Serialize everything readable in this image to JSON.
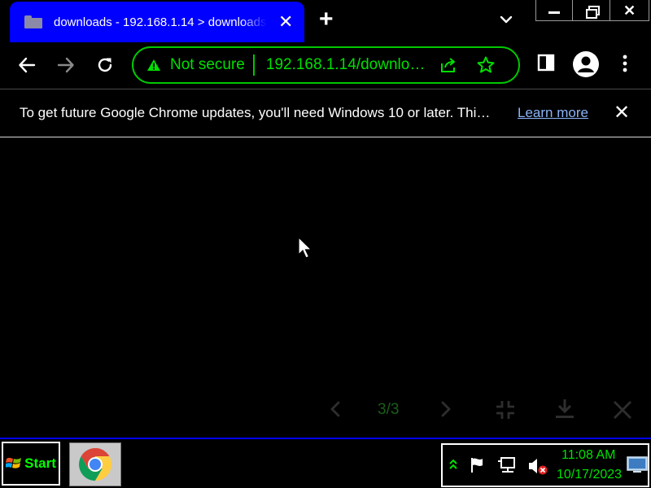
{
  "browser": {
    "tab": {
      "title": "downloads - 192.168.1.14 > downloads"
    },
    "omnibox": {
      "security_label": "Not secure",
      "url": "192.168.1.14/downloads"
    },
    "infobar": {
      "message": "To get future Google Chrome updates, you'll need Windows 10 or later. Thi…",
      "link_label": "Learn more"
    }
  },
  "viewer": {
    "counter": "3/3"
  },
  "taskbar": {
    "start_label": "Start",
    "clock_time": "11:08 AM",
    "clock_date": "10/17/2023"
  },
  "colors": {
    "tab_active": "#0000ff",
    "accent_green": "#00e000",
    "link_blue": "#8ab4f8",
    "background": "#000000"
  }
}
